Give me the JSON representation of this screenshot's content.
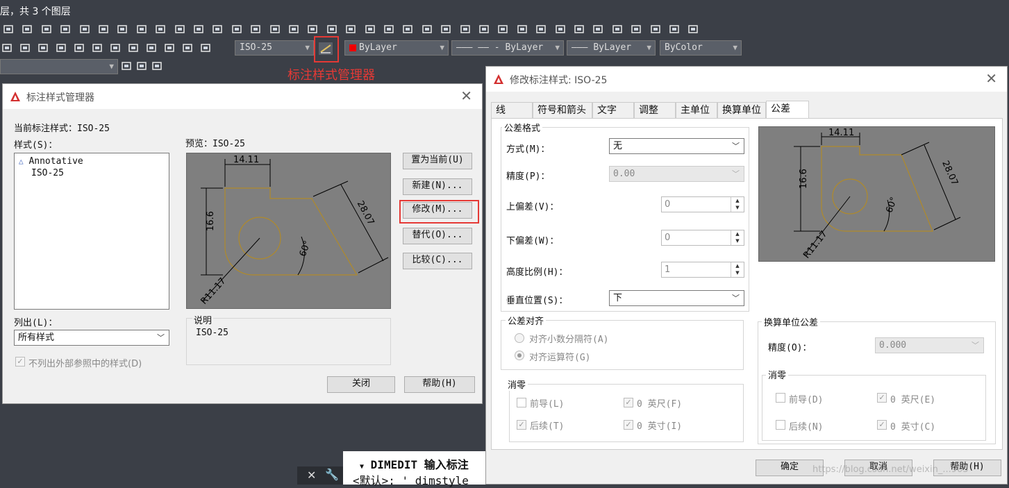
{
  "app": {
    "title_fragment": "层，共 3 个图层"
  },
  "toolbar": {
    "dimstyle_combo": "ISO-25",
    "color_combo": "ByLayer",
    "linetype_combo": "ByLayer",
    "lineweight_combo": "ByLayer",
    "plotstyle_combo": "ByColor",
    "annotation": "标注样式管理器"
  },
  "manager": {
    "title": "标注样式管理器",
    "current_label": "当前标注样式：ISO-25",
    "styles_label": "样式(S)：",
    "styles": [
      "Annotative",
      "ISO-25"
    ],
    "preview_label": "预览：ISO-25",
    "list_label": "列出(L)：",
    "list_value": "所有样式",
    "xref_checkbox": "不列出外部参照中的样式(D)",
    "desc_label": "说明",
    "desc_value": "ISO-25",
    "buttons": {
      "set_current": "置为当前(U)",
      "new": "新建(N)...",
      "modify": "修改(M)...",
      "override": "替代(O)...",
      "compare": "比较(C)...",
      "close": "关闭",
      "help": "帮助(H)"
    }
  },
  "preview_dims": {
    "width": "14.11",
    "height": "16.6",
    "diag": "28.07",
    "angle": "60°",
    "radius": "R11.17"
  },
  "modify": {
    "title": "修改标注样式: ISO-25",
    "tabs": [
      "线",
      "符号和箭头",
      "文字",
      "调整",
      "主单位",
      "换算单位",
      "公差"
    ],
    "tolerance_group": "公差格式",
    "method_label": "方式(M)：",
    "method_value": "无",
    "precision_label": "精度(P)：",
    "precision_value": "0.00",
    "upper_label": "上偏差(V)：",
    "upper_value": "0",
    "lower_label": "下偏差(W)：",
    "lower_value": "0",
    "scale_label": "高度比例(H)：",
    "scale_value": "1",
    "vpos_label": "垂直位置(S)：",
    "vpos_value": "下",
    "align_group": "公差对齐",
    "align_decimal": "对齐小数分隔符(A)",
    "align_operator": "对齐运算符(G)",
    "zero_group": "消零",
    "leading": "前导(L)",
    "trailing": "后续(T)",
    "zero_feet": "0  英尺(F)",
    "zero_inch": "0  英寸(I)",
    "alt_group": "换算单位公差",
    "alt_precision_label": "精度(O)：",
    "alt_precision_value": "0.000",
    "alt_zero_group": "消零",
    "alt_leading": "前导(D)",
    "alt_trailing": "后续(N)",
    "alt_zero_feet": "0  英尺(E)",
    "alt_zero_inch": "0  英寸(C)",
    "ok": "确定",
    "cancel": "取消",
    "help": "帮助(H)"
  },
  "command": {
    "line1": "DIMEDIT 输入标注",
    "line2": "<默认>: ' dimstyle"
  },
  "watermark": "https://blog.csdn.net/weixin_...903"
}
